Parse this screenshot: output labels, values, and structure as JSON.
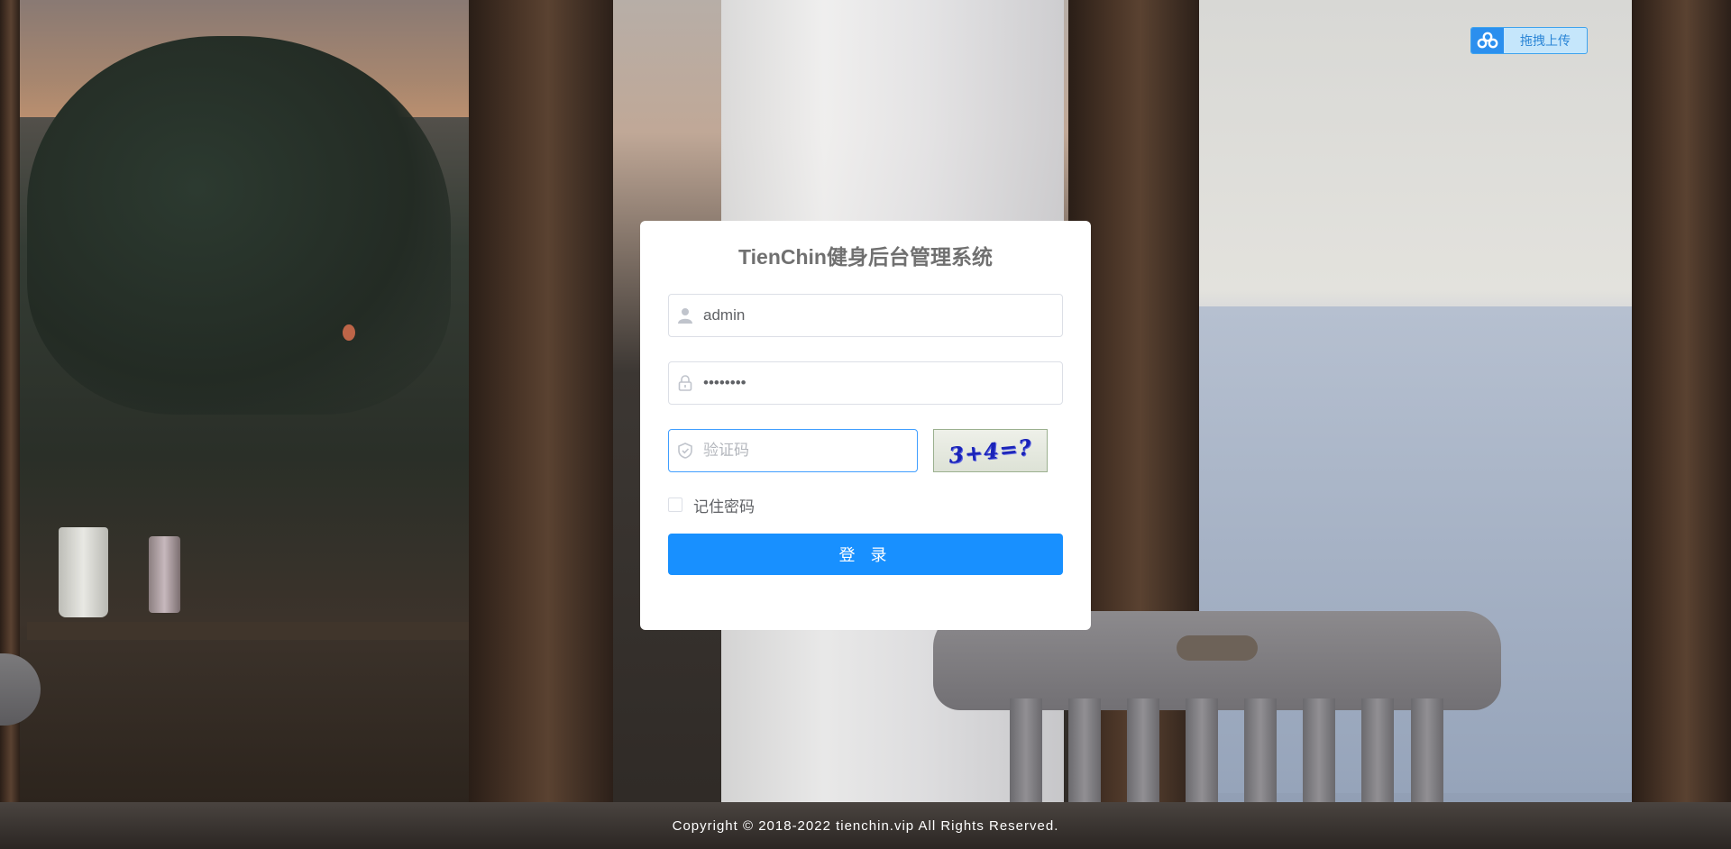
{
  "upload_widget": {
    "label": "拖拽上传",
    "icon": "cloud-icon"
  },
  "login": {
    "title": "TienChin健身后台管理系统",
    "username": {
      "value": "admin",
      "icon": "user-icon"
    },
    "password": {
      "value": "••••••••",
      "icon": "lock-icon"
    },
    "captcha": {
      "placeholder": "验证码",
      "icon": "shield-icon",
      "image_text": "3+4=?"
    },
    "remember_label": "记住密码",
    "submit_label": "登 录"
  },
  "footer": {
    "copyright": "Copyright © 2018-2022 tienchin.vip All Rights Reserved."
  },
  "colors": {
    "primary": "#1890ff",
    "focus_border": "#409eff",
    "upload_accent": "#2b8fee"
  }
}
